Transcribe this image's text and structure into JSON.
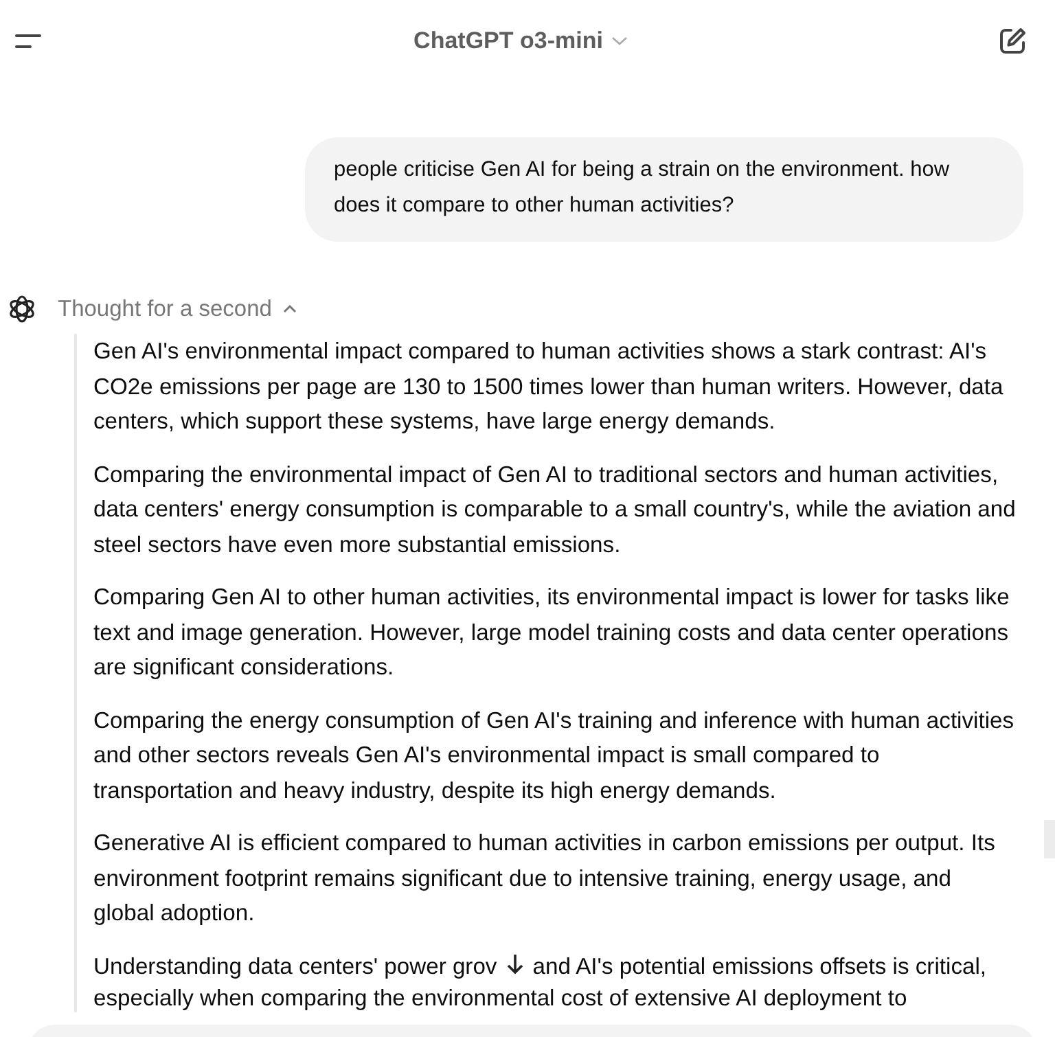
{
  "header": {
    "title": "ChatGPT o3-mini"
  },
  "user_message": {
    "text": "people criticise Gen AI for being a strain on the environment. how does it compare to other human activities?"
  },
  "reasoning": {
    "label": "Thought for a second",
    "expanded": true,
    "paragraphs": [
      {
        "text": "Gen AI's environmental impact compared to human activities shows a stark contrast: AI's CO2e emissions per page are 130 to 1500 times lower than human writers. However, data centers, which support these systems, have large energy demands."
      },
      {
        "text": "Comparing the environmental impact of Gen AI to traditional sectors and human activities, data centers' energy consumption is comparable to a small country's, while the aviation and steel sectors have even more substantial emissions."
      },
      {
        "text": "Comparing Gen AI to other human activities, its environmental impact is lower for tasks like text and image generation. However, large model training costs and data center operations are significant considerations."
      },
      {
        "text": "Comparing the energy consumption of Gen AI's training and inference with human activities and other sectors reveals Gen AI's environmental impact is small compared to transportation and heavy industry, despite its high energy demands."
      },
      {
        "text": "Generative AI is efficient compared to human activities in carbon emissions per output. Its environment footprint remains significant due to intensive training, energy usage, and global adoption."
      }
    ],
    "last_paragraph": {
      "text_before": "Understanding data centers' power grov",
      "text_after": "and AI's potential emissions offsets is critical,",
      "next_line": "especially when comparing the environmental cost of extensive AI deployment to"
    }
  }
}
